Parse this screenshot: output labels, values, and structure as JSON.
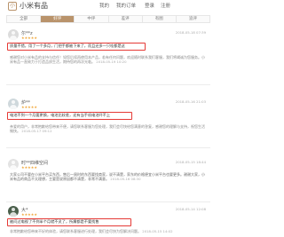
{
  "header": {
    "logo_char": "小",
    "brand": "小米有品",
    "nav": [
      "我的",
      "我的订单",
      "登录",
      "注册"
    ]
  },
  "tabs": [
    {
      "label": "全部",
      "active": false
    },
    {
      "label": "好评",
      "active": true
    },
    {
      "label": "中评",
      "active": false
    },
    {
      "label": "差评",
      "active": false
    },
    {
      "label": "有图",
      "active": false
    },
    {
      "label": "追评",
      "active": false
    }
  ],
  "reviews": [
    {
      "username": "尔**z",
      "stars": "★★★★★",
      "date": "2018-05-18 07:39",
      "highlight": "质量不错，用了一个多月，门把手都被下来了，而且还多一只哇都是这",
      "reply": "感谢您对小米有品的支持与信任！如您后续再使用本产品，若有任何问题，欢迎随时联系我们客服，我们将竭诚为您服务。小米有品一直致力于打造品质生活，期待您的再次光临。",
      "reply_date": "2018-05-19 10:20"
    },
    {
      "username": "炉**",
      "stars": "★★★★★",
      "date": "2018-05-16 21:03",
      "highlight": "电池不到一个月要更换，电池比较差，还有当手机电池坏不上",
      "reply": "亲爱的用户，非常抱歉给您带来不便，请您联系客服为您处理，我们会尽快给您满意的答复，感谢您的理解与支持，祝您生活愉快。",
      "reply_date": "2018-05-17 09:12"
    },
    {
      "username": "时**四维空间",
      "stars": "★★★★★",
      "date": "2018-05-15 18:44",
      "highlight": "",
      "reply": "大家公司不要在小米平台买东西，售后一周时的东西要找商家，说不清楚，家东的价格便宜小米平台也要更多。谢谢大家，小米有品的商品不太理想，主要是说原因都不清楚，非常不满意。",
      "reply_date": "2018-05-16 08:30"
    },
    {
      "username": "大*",
      "stars": "★★★★★",
      "date": "2018-05-14 12:08",
      "highlight": "被问过电视了不到半个月就不灵了，所属都是不要找售",
      "reply": "非常抱歉给您带来不好的体验，请您联系客服进行处理，我们会尽快为您解决问题。",
      "reply_date": "2018-05-15 14:02"
    }
  ]
}
